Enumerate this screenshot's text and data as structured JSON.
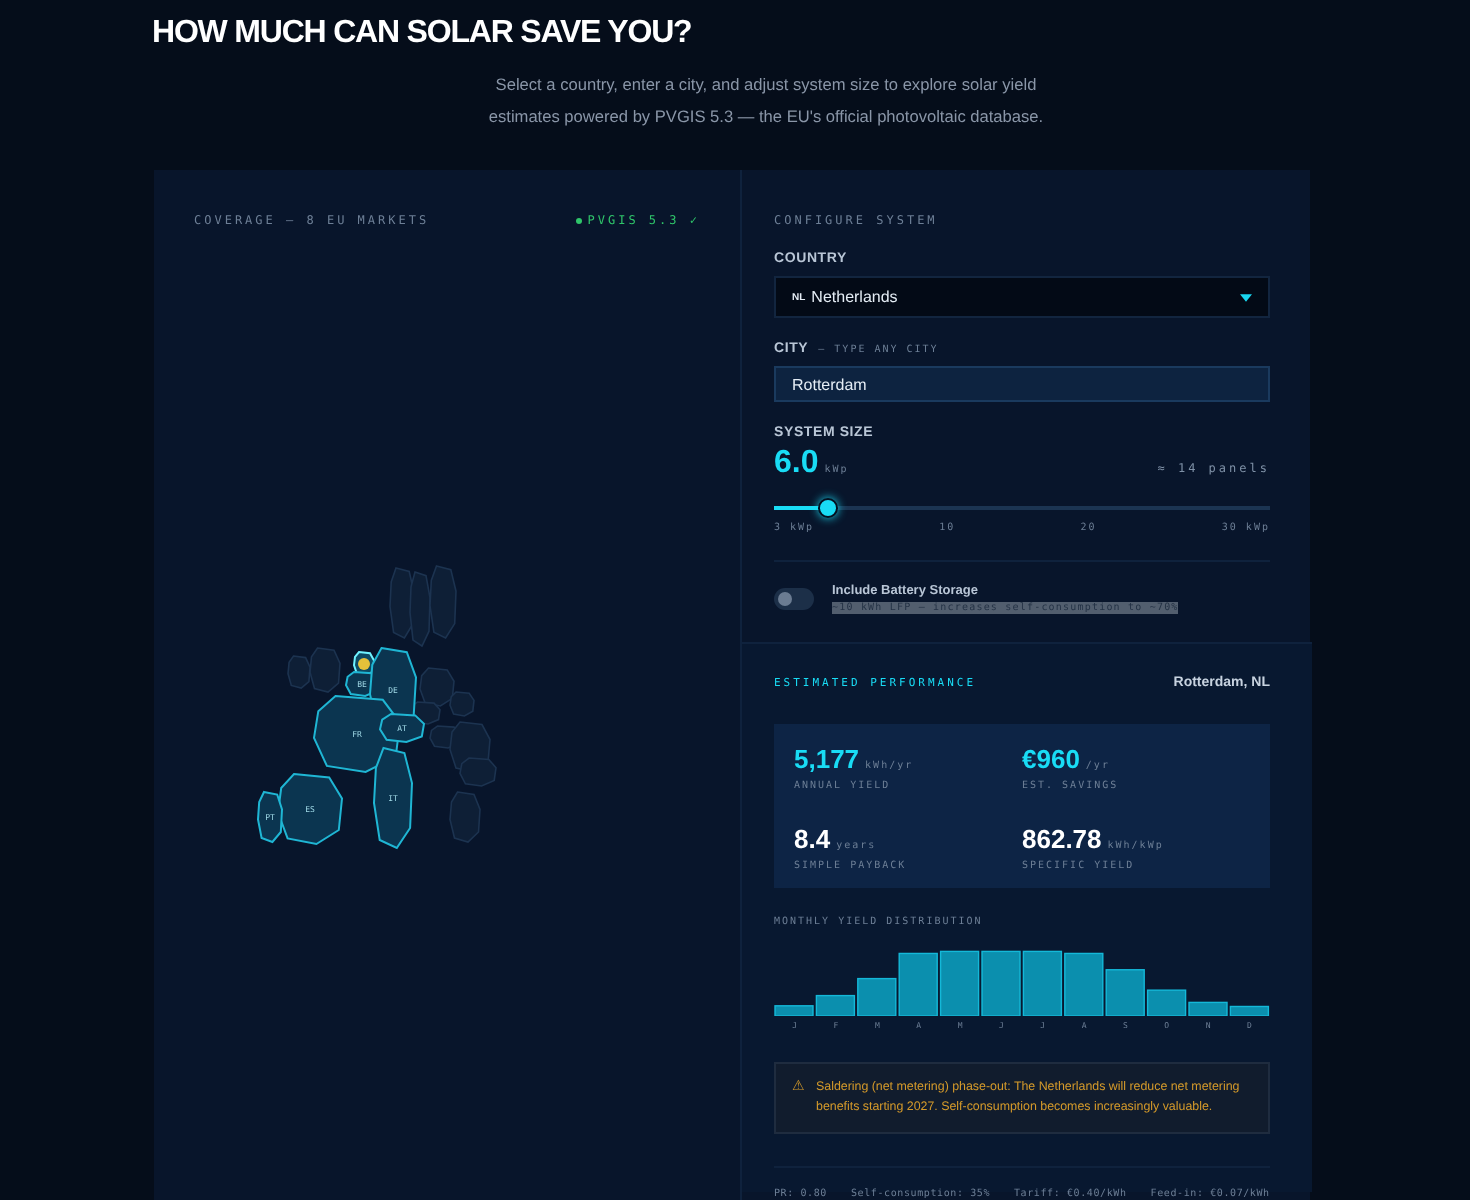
{
  "title": "HOW MUCH CAN SOLAR SAVE YOU?",
  "subtitle": "Select a country, enter a city, and adjust system size to explore solar yield estimates powered by PVGIS 5.3 — the EU's official photovoltaic database.",
  "coverage": {
    "heading": "COVERAGE — 8 EU MARKETS",
    "source": "PVGIS 5.3 ✓",
    "source_ok": true,
    "markets": [
      {
        "selected": true
      },
      {
        "code": "BE",
        "selected": false
      },
      {
        "code": "DE",
        "selected": false
      },
      {
        "code": "FR",
        "selected": false
      },
      {
        "code": "AT",
        "selected": false
      },
      {
        "code": "IT",
        "selected": false
      },
      {
        "code": "ES",
        "selected": false
      },
      {
        "code": "PT",
        "selected": false
      }
    ]
  },
  "config": {
    "heading": "CONFIGURE SYSTEM",
    "country": {
      "label": "COUNTRY",
      "flag": "NL",
      "value": "Netherlands"
    },
    "city": {
      "label": "CITY",
      "hint": "— TYPE ANY CITY",
      "value": "Rotterdam"
    },
    "size": {
      "label": "SYSTEM SIZE",
      "value": "6.0",
      "unit": "kWp",
      "panels": "≈ 14 panels",
      "level": 0.11,
      "ticks": [
        "3 kWp",
        "10",
        "20",
        "30 kWp"
      ]
    },
    "battery": {
      "label": "Include Battery Storage",
      "note": "~10 kWh LFP — increases self-consumption to ~70%",
      "on": false
    }
  },
  "results": {
    "heading": "ESTIMATED PERFORMANCE",
    "location": "Rotterdam, NL",
    "metrics": [
      {
        "value": "5,177",
        "unit": "kWh/yr",
        "label": "ANNUAL YIELD",
        "accent": true
      },
      {
        "value": "€960",
        "unit": "/yr",
        "label": "EST. SAVINGS",
        "accent": true
      },
      {
        "value": "8.4",
        "unit": "years",
        "label": "SIMPLE PAYBACK",
        "accent": false
      },
      {
        "value": "862.78",
        "unit": "kWh/kWp",
        "label": "SPECIFIC YIELD",
        "accent": false
      }
    ],
    "monthly": {
      "heading": "MONTHLY YIELD DISTRIBUTION",
      "months": [
        "J",
        "F",
        "M",
        "A",
        "M",
        "J",
        "J",
        "A",
        "S",
        "O",
        "N",
        "D"
      ]
    },
    "alert": {
      "icon": "⚠",
      "text": "Saldering (net metering) phase-out: The Netherlands will reduce net metering benefits starting 2027. Self-consumption becomes increasingly valuable."
    },
    "footer": [
      "PR: 0.80",
      "Self-consumption: 35%",
      "Tariff: €0.40/kWh",
      "Feed-in: €0.07/kWh"
    ]
  }
}
